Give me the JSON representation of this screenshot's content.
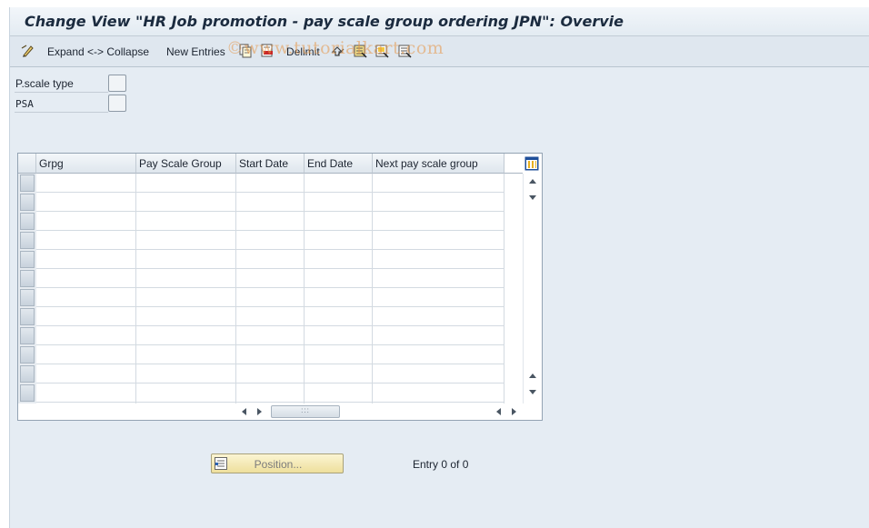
{
  "window": {
    "title": "Change View \"HR Job promotion - pay scale group ordering JPN\": Overvie"
  },
  "toolbar": {
    "expand_collapse_label": "Expand <-> Collapse",
    "new_entries_label": "New Entries",
    "delimit_label": "Delimit",
    "watermark_text": "©www.tutorialkart.com"
  },
  "fields": {
    "pscale_type_label": "P.scale type",
    "psa_label": "PSA",
    "pscale_type_value": "",
    "psa_value": ""
  },
  "table": {
    "columns": [
      "Grpg",
      "Pay Scale Group",
      "Start Date",
      "End Date",
      "Next pay scale group"
    ],
    "rows": [
      [
        "",
        "",
        "",
        "",
        ""
      ],
      [
        "",
        "",
        "",
        "",
        ""
      ],
      [
        "",
        "",
        "",
        "",
        ""
      ],
      [
        "",
        "",
        "",
        "",
        ""
      ],
      [
        "",
        "",
        "",
        "",
        ""
      ],
      [
        "",
        "",
        "",
        "",
        ""
      ],
      [
        "",
        "",
        "",
        "",
        ""
      ],
      [
        "",
        "",
        "",
        "",
        ""
      ],
      [
        "",
        "",
        "",
        "",
        ""
      ],
      [
        "",
        "",
        "",
        "",
        ""
      ],
      [
        "",
        "",
        "",
        "",
        ""
      ],
      [
        "",
        "",
        "",
        "",
        ""
      ]
    ],
    "hscroll_thumb_label": ":::"
  },
  "footer": {
    "position_button_label": "Position...",
    "entry_count_text": "Entry 0 of 0"
  },
  "colors": {
    "background": "#e5ecf3",
    "button_yellow": "#f5ebb8",
    "header_bg": "#dfe6ed"
  },
  "icons": [
    "edit-pencil-icon",
    "copy-icon",
    "delete-icon",
    "undo-icon",
    "select-all-icon",
    "select-block-icon",
    "deselect-all-icon",
    "column-config-icon",
    "position-icon"
  ]
}
